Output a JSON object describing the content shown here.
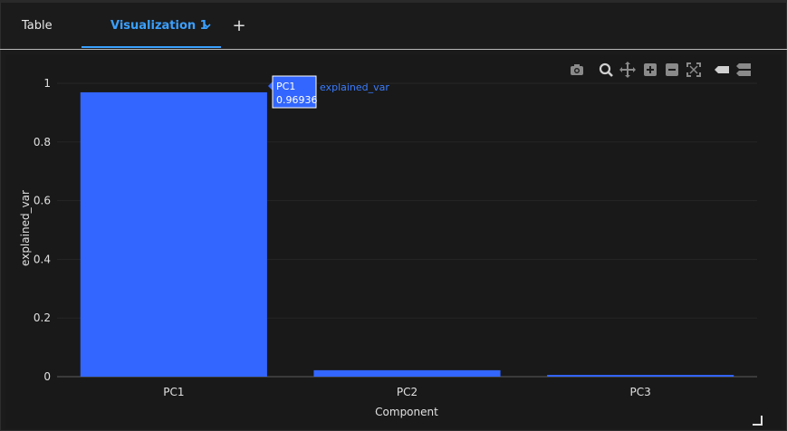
{
  "tabs": {
    "table_label": "Table",
    "viz_label": "Visualization 1"
  },
  "toolbar_icons": [
    "camera-icon",
    "zoom-icon",
    "pan-icon",
    "zoom-in-icon",
    "zoom-out-icon",
    "autoscale-icon",
    "hover-closest-icon",
    "hover-compare-icon"
  ],
  "colors": {
    "accent": "#3aa0ff",
    "bar": "#3366ff",
    "background": "#1b1b1b"
  },
  "chart_data": {
    "type": "bar",
    "categories": [
      "PC1",
      "PC2",
      "PC3"
    ],
    "values": [
      0.96936,
      0.022,
      0.006
    ],
    "xlabel": "Component",
    "ylabel": "explained_var",
    "ylim": [
      0,
      1.04
    ],
    "yticks": [
      "0",
      "0.2",
      "0.4",
      "0.6",
      "0.8",
      "1"
    ],
    "ytick_values": [
      0,
      0.2,
      0.4,
      0.6,
      0.8,
      1
    ],
    "grid": true,
    "tooltip": {
      "category": "PC1",
      "value": "0.96936",
      "series": "explained_var"
    }
  }
}
